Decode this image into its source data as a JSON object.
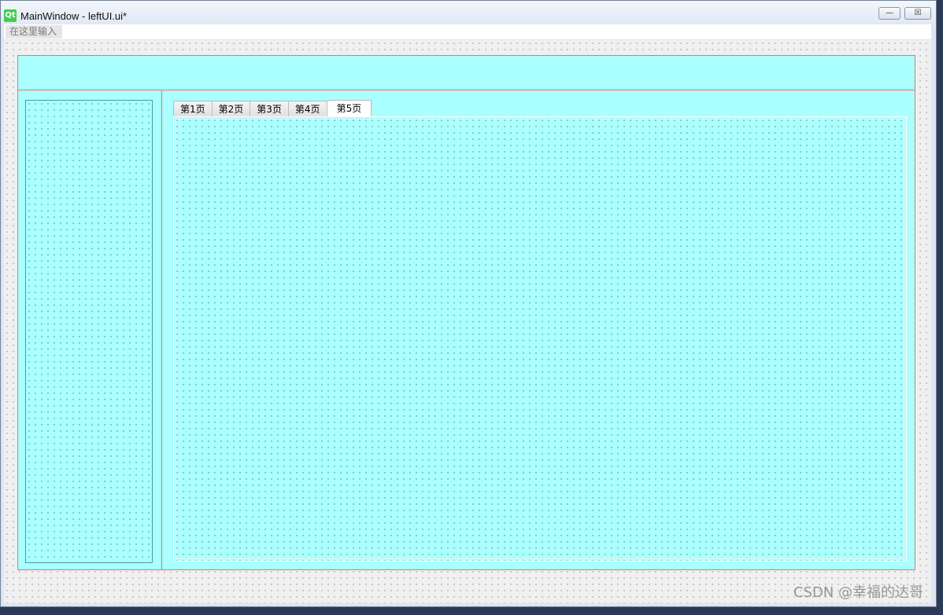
{
  "window": {
    "title": "MainWindow - leftUI.ui*",
    "logo_text": "Qt",
    "minimize_glyph": "—",
    "close_glyph": "☒"
  },
  "menubar": {
    "placeholder": "在这里输入"
  },
  "tabs": [
    {
      "label": "第1页"
    },
    {
      "label": "第2页"
    },
    {
      "label": "第3页"
    },
    {
      "label": "第4页"
    },
    {
      "label": "第5页",
      "active": true
    }
  ],
  "watermark": "CSDN @幸福的达哥",
  "colors": {
    "panel_bg": "#aaffff",
    "frame_border": "#e07a6a",
    "designer_bg": "#f0f0f0"
  },
  "icons": [
    "qt-logo-icon",
    "minimize-icon",
    "close-icon"
  ]
}
